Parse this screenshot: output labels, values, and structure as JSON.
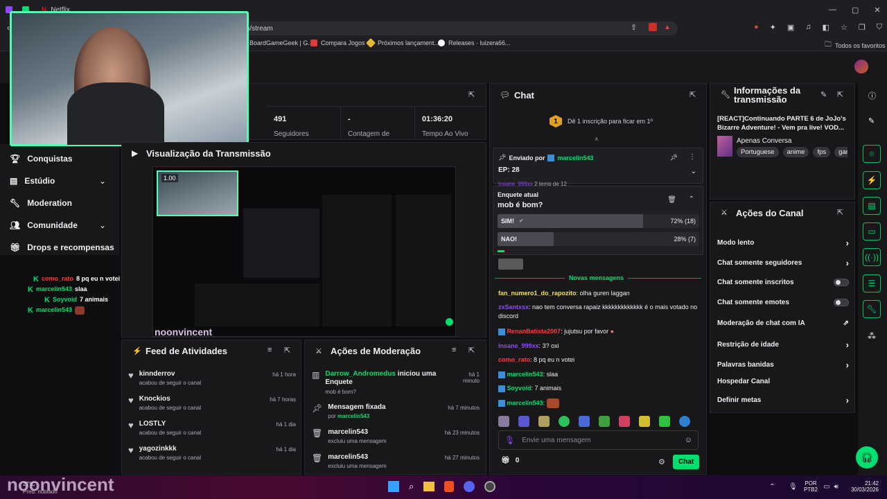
{
  "browser": {
    "tab_title": "Netflix",
    "url": "m/stream",
    "bookmarks": [
      "BoardGameGeek | G...",
      "Compara Jogos",
      "Próximos lançament...",
      "Releases · luizera66..."
    ],
    "favorites": "Todos os favoritos"
  },
  "stats": [
    {
      "value": "491",
      "label": "Seguidores"
    },
    {
      "value": "-",
      "label": "Contagem de"
    },
    {
      "value": "01:36:20",
      "label": "Tempo Ao Vivo"
    }
  ],
  "sidebar": {
    "items": [
      {
        "label": "Conquistas"
      },
      {
        "label": "Estúdio"
      },
      {
        "label": "Moderation"
      },
      {
        "label": "Comunidade"
      },
      {
        "label": "Drops e recompensas"
      }
    ]
  },
  "overlay_chat": [
    {
      "user": "como_rato",
      "msg": "8 pq eu n votei"
    },
    {
      "user": "marcelin543",
      "msg": "slaa"
    },
    {
      "user": "Soyvoid",
      "msg": "7 animais"
    },
    {
      "user": "marcelin543",
      "msg": ""
    }
  ],
  "preview": {
    "title": "Visualização da Transmissão",
    "zoom": "1.00",
    "watermark": "noonvincent"
  },
  "feed": {
    "title": "Feed de Atividades",
    "items": [
      {
        "name": "kinnderrov",
        "desc": "acabou de seguir o canal",
        "time": "há 1 hora"
      },
      {
        "name": "Knockios",
        "desc": "acabou de seguir o canal",
        "time": "há 7 horas"
      },
      {
        "name": "LOSTLY",
        "desc": "acabou de seguir o canal",
        "time": "há 1 dia"
      },
      {
        "name": "yagozinkkk",
        "desc": "acabou de seguir o canal",
        "time": "há 1 dia"
      }
    ]
  },
  "mod": {
    "title": "Ações de Moderação",
    "items": [
      {
        "user": "Darrow_Andromedus",
        "action": " iniciou uma Enquete",
        "sub": "mob é bom?",
        "time": "há 1 minuto"
      },
      {
        "user": "Mensagem fixada",
        "action": "",
        "sub_prefix": "por ",
        "sub_user": "marcelin543",
        "time": "há 7 minutos"
      },
      {
        "user": "marcelin543",
        "action": "",
        "sub": "excluiu uma mensagem",
        "time": "há 23 minutos"
      },
      {
        "user": "marcelin543",
        "action": "",
        "sub": "excluiu uma mensagem",
        "time": "há 27 minutos"
      }
    ]
  },
  "chat": {
    "title": "Chat",
    "sub_banner": "Dê 1 inscrição para ficar em 1º",
    "sub_rank": "1",
    "pinned": {
      "prefix": "Enviado por",
      "user": "marcelin543",
      "text": "EP: 28"
    },
    "behind": "2 temp de 12",
    "poll": {
      "label": "Enquete atual",
      "question": "mob é bom?",
      "options": [
        {
          "label": "SIM!",
          "result": "72% (18)",
          "pct": 72
        },
        {
          "label": "NAO!",
          "result": "28% (7)",
          "pct": 28
        }
      ]
    },
    "new_messages": "Novas mensagens",
    "messages": [
      {
        "user": "fan_numero1_do_rapozito",
        "color": "#f2e34a",
        "text": "olha guren laggan"
      },
      {
        "user": "zxSantxsx",
        "color": "#9147ff",
        "text": "nao tem conversa rapaiz kkkkkkkkkkkkk é o mais votado no discord"
      },
      {
        "user": "RenanBatista2007",
        "color": "#ff3b3b",
        "text": "jujutsu por favor"
      },
      {
        "user": "Insane_999xx",
        "color": "#9147ff",
        "text": "3? oxi"
      },
      {
        "user": "como_rato",
        "color": "#ff3b3b",
        "text": "8 pq eu n votei"
      },
      {
        "user": "marcelin543",
        "color": "#00e070",
        "text": "slaa"
      },
      {
        "user": "Soyvoid",
        "color": "#00e070",
        "text": "7 animais"
      },
      {
        "user": "marcelin543",
        "color": "#00e070",
        "text": ""
      }
    ],
    "input_placeholder": "Envie uma mensagem",
    "points": "0",
    "send_label": "Chat"
  },
  "info": {
    "title": "Informações da transmissão",
    "stream_title": "[REACT]Continuando PARTE 6 de JoJo's Bizarre Adventure! - Vem pra live! VOD...",
    "category": "Apenas Conversa",
    "tags": [
      "Portuguese",
      "anime",
      "fps",
      "gam"
    ]
  },
  "actions": {
    "title": "Ações do Canal",
    "items": [
      {
        "label": "Modo lento",
        "kind": "chevron"
      },
      {
        "label": "Chat somente seguidores",
        "kind": "chevron"
      },
      {
        "label": "Chat somente inscritos",
        "kind": "toggle"
      },
      {
        "label": "Chat somente emotes",
        "kind": "toggle"
      },
      {
        "label": "Moderação de chat com IA",
        "kind": "external"
      },
      {
        "label": "Restrição de idade",
        "kind": "chevron"
      },
      {
        "label": "Palavras banidas",
        "kind": "chevron"
      },
      {
        "label": "Hospedar Canal",
        "kind": "none"
      },
      {
        "label": "Definir metas",
        "kind": "chevron"
      }
    ]
  },
  "taskbar": {
    "temp": "27°C",
    "weather": "Pred. nublado",
    "lang": "POR",
    "kb": "PTB2",
    "time": "21:42",
    "date": "30/03/2026",
    "brand": "noonvincent"
  },
  "colors": {
    "accent": "#00e070",
    "twitch_purple": "#9147ff",
    "bg": "#0e0e10"
  }
}
